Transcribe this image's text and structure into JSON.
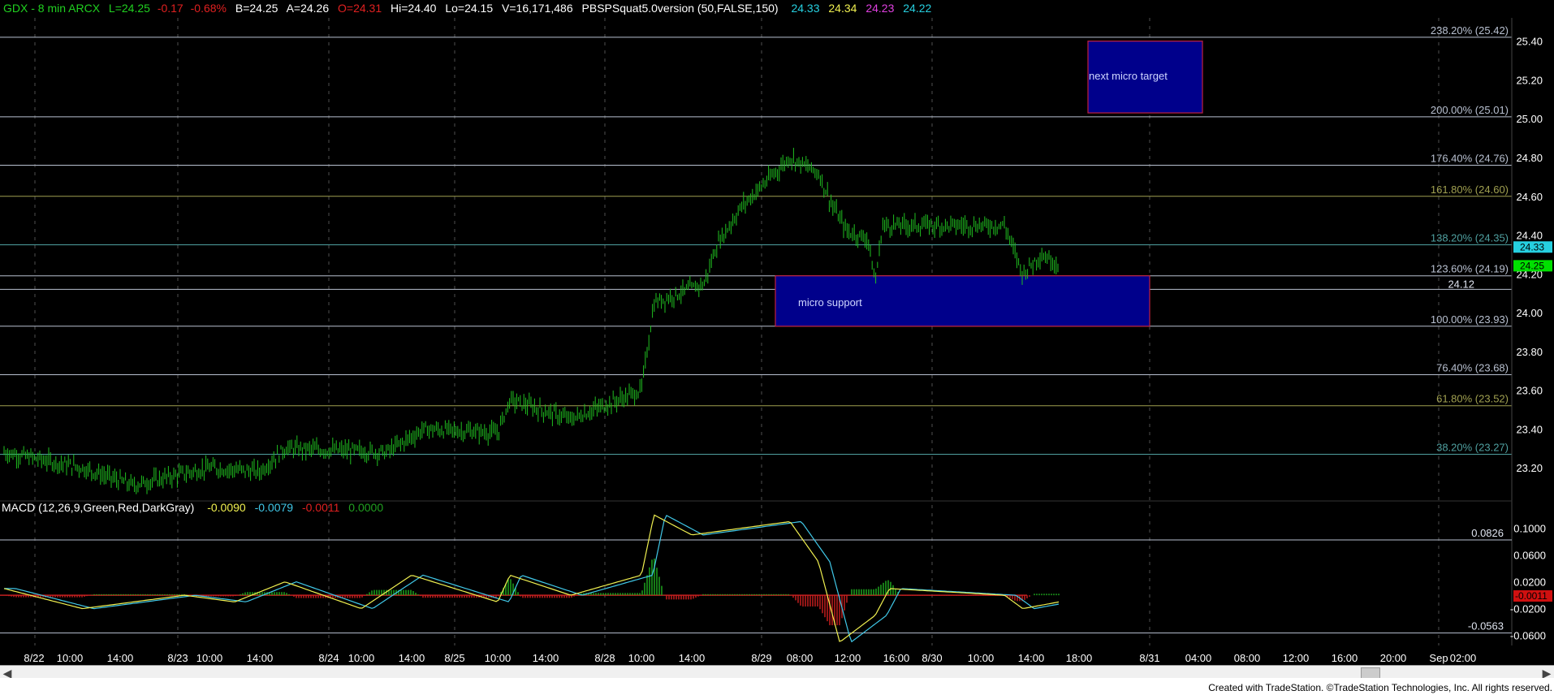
{
  "header": {
    "symbol": "GDX - 8 min  ARCX",
    "last": "L=24.25",
    "change": "-0.17",
    "change_pct": "-0.68%",
    "bid": "B=24.25",
    "ask": "A=24.26",
    "open": "O=24.31",
    "high": "Hi=24.40",
    "low": "Lo=24.15",
    "volume": "V=16,171,486",
    "indicator": "PBSPSquat5.0version (50,FALSE,150)",
    "ind_values": [
      {
        "text": "24.33",
        "color": "#26d0e0"
      },
      {
        "text": "24.34",
        "color": "#f0f050"
      },
      {
        "text": "24.23",
        "color": "#e040e0"
      },
      {
        "text": "24.22",
        "color": "#26d0e0"
      }
    ]
  },
  "macd_header": {
    "label": "MACD (12,26,9,Green,Red,DarkGray)",
    "values": [
      {
        "text": "-0.0090",
        "color": "#f0f050"
      },
      {
        "text": "-0.0079",
        "color": "#40c8e8"
      },
      {
        "text": "-0.0011",
        "color": "#e02020"
      },
      {
        "text": "0.0000",
        "color": "#20a020"
      }
    ]
  },
  "colors": {
    "background": "#000000",
    "price_bar": "#20c020",
    "fib_white": "#b8c0d0",
    "fib_teal": "#4fa0a0",
    "fib_olive": "#a0a050",
    "box_fill": "#00008b",
    "box_border": "#c02040",
    "macd_line": "#f0f050",
    "signal_line": "#40c8e8",
    "hist_pos": "#20b020",
    "hist_neg": "#d02020"
  },
  "chart_data": {
    "type": "candlestick",
    "title": "GDX - 8 min",
    "price_axis": {
      "ylim": [
        23.05,
        25.52
      ],
      "ticks": [
        "25.40",
        "25.20",
        "25.00",
        "24.80",
        "24.60",
        "24.40",
        "24.20",
        "24.00",
        "23.80",
        "23.60",
        "23.40",
        "23.20"
      ]
    },
    "time_axis": {
      "labels": [
        "8/22",
        "10:00",
        "14:00",
        "8/23",
        "10:00",
        "14:00",
        "8/24",
        "10:00",
        "14:00",
        "8/25",
        "10:00",
        "14:00",
        "8/28",
        "10:00",
        "14:00",
        "8/29",
        "08:00",
        "12:00",
        "16:00",
        "8/30",
        "10:00",
        "14:00",
        "18:00",
        "8/31",
        "04:00",
        "08:00",
        "12:00",
        "16:00",
        "20:00",
        "Sep",
        "02:00"
      ]
    },
    "price_path": [
      {
        "t": "8/22 start",
        "price": 23.28
      },
      {
        "t": "8/22 11:00",
        "price": 23.2
      },
      {
        "t": "8/22 15:00",
        "price": 23.11
      },
      {
        "t": "8/23 10:00",
        "price": 23.2
      },
      {
        "t": "8/23 14:00",
        "price": 23.18
      },
      {
        "t": "8/23 16:00",
        "price": 23.3
      },
      {
        "t": "8/24 12:00",
        "price": 23.28
      },
      {
        "t": "8/24 15:00",
        "price": 23.4
      },
      {
        "t": "8/25 10:00",
        "price": 23.38
      },
      {
        "t": "8/25 11:00",
        "price": 23.55
      },
      {
        "t": "8/25 16:00",
        "price": 23.45
      },
      {
        "t": "8/28 10:00",
        "price": 23.6
      },
      {
        "t": "8/28 11:00",
        "price": 24.05
      },
      {
        "t": "8/28 15:00",
        "price": 24.15
      },
      {
        "t": "8/28 16:00",
        "price": 24.35
      },
      {
        "t": "8/28 18:00",
        "price": 24.55
      },
      {
        "t": "8/29 04:00",
        "price": 24.8
      },
      {
        "t": "8/29 08:00",
        "price": 24.72
      },
      {
        "t": "8/29 10:00",
        "price": 24.55
      },
      {
        "t": "8/29 12:00",
        "price": 24.42
      },
      {
        "t": "8/29 15:00",
        "price": 24.38
      },
      {
        "t": "8/29 16:00",
        "price": 24.15
      },
      {
        "t": "8/29 17:00",
        "price": 24.45
      },
      {
        "t": "8/30 08:00",
        "price": 24.45
      },
      {
        "t": "8/30 10:00",
        "price": 24.2
      },
      {
        "t": "8/30 12:00",
        "price": 24.3
      },
      {
        "t": "8/30 14:00",
        "price": 24.25
      }
    ],
    "fib_levels": [
      {
        "label": "238.20% (25.42)",
        "price": 25.42,
        "color": "white"
      },
      {
        "label": "200.00% (25.01)",
        "price": 25.01,
        "color": "white"
      },
      {
        "label": "176.40% (24.76)",
        "price": 24.76,
        "color": "white"
      },
      {
        "label": "161.80% (24.60)",
        "price": 24.6,
        "color": "olive"
      },
      {
        "label": "138.20% (24.35)",
        "price": 24.35,
        "color": "teal"
      },
      {
        "label": "123.60% (24.19)",
        "price": 24.19,
        "color": "white"
      },
      {
        "label": "100.00% (23.93)",
        "price": 23.93,
        "color": "white"
      },
      {
        "label": "76.40% (23.68)",
        "price": 23.68,
        "color": "white"
      },
      {
        "label": "61.80% (23.52)",
        "price": 23.52,
        "color": "olive"
      },
      {
        "label": "38.20% (23.27)",
        "price": 23.27,
        "color": "teal"
      }
    ],
    "support_line": {
      "label": "24.12",
      "price": 24.12
    },
    "boxes": [
      {
        "label": "next micro target",
        "price_top": 25.4,
        "price_bottom": 25.03,
        "t_start": "8/30 18:00",
        "t_end": "8/31 02:00"
      },
      {
        "label": "micro support",
        "price_top": 24.19,
        "price_bottom": 23.93,
        "t_start": "8/29 10:00",
        "t_end": "8/31 00:00"
      }
    ],
    "last_price_tags": [
      {
        "text": "24.33",
        "price": 24.33,
        "bg": "#26d0e0"
      },
      {
        "text": "24.25",
        "price": 24.25,
        "bg": "#00e000"
      }
    ],
    "macd": {
      "ylim": [
        -0.075,
        0.125
      ],
      "ticks": [
        "0.1000",
        "0.0600",
        "0.0200",
        "-0.0200",
        "-0.0600"
      ],
      "levels": [
        {
          "label": "0.0826",
          "value": 0.0826
        },
        {
          "label": "-0.0563",
          "value": -0.0563
        }
      ],
      "current_tag": "-0.0011",
      "macd_path": [
        {
          "t": "8/22 start",
          "v": 0.01
        },
        {
          "t": "8/22 11:00",
          "v": -0.02
        },
        {
          "t": "8/23 08:00",
          "v": 0.0
        },
        {
          "t": "8/23 12:00",
          "v": -0.01
        },
        {
          "t": "8/23 16:00",
          "v": 0.02
        },
        {
          "t": "8/24 10:00",
          "v": -0.02
        },
        {
          "t": "8/24 14:00",
          "v": 0.03
        },
        {
          "t": "8/25 10:00",
          "v": -0.01
        },
        {
          "t": "8/25 11:00",
          "v": 0.03
        },
        {
          "t": "8/25 16:00",
          "v": 0.0
        },
        {
          "t": "8/28 10:00",
          "v": 0.03
        },
        {
          "t": "8/28 11:00",
          "v": 0.12
        },
        {
          "t": "8/28 14:00",
          "v": 0.09
        },
        {
          "t": "8/29 04:00",
          "v": 0.11
        },
        {
          "t": "8/29 08:00",
          "v": 0.05
        },
        {
          "t": "8/29 11:00",
          "v": -0.07
        },
        {
          "t": "8/29 16:00",
          "v": -0.03
        },
        {
          "t": "8/29 18:00",
          "v": 0.01
        },
        {
          "t": "8/30 08:00",
          "v": 0.0
        },
        {
          "t": "8/30 10:00",
          "v": -0.02
        },
        {
          "t": "8/30 14:00",
          "v": -0.01
        }
      ]
    }
  },
  "credit": "Created with TradeStation. ©TradeStation Technologies, Inc. All rights reserved."
}
